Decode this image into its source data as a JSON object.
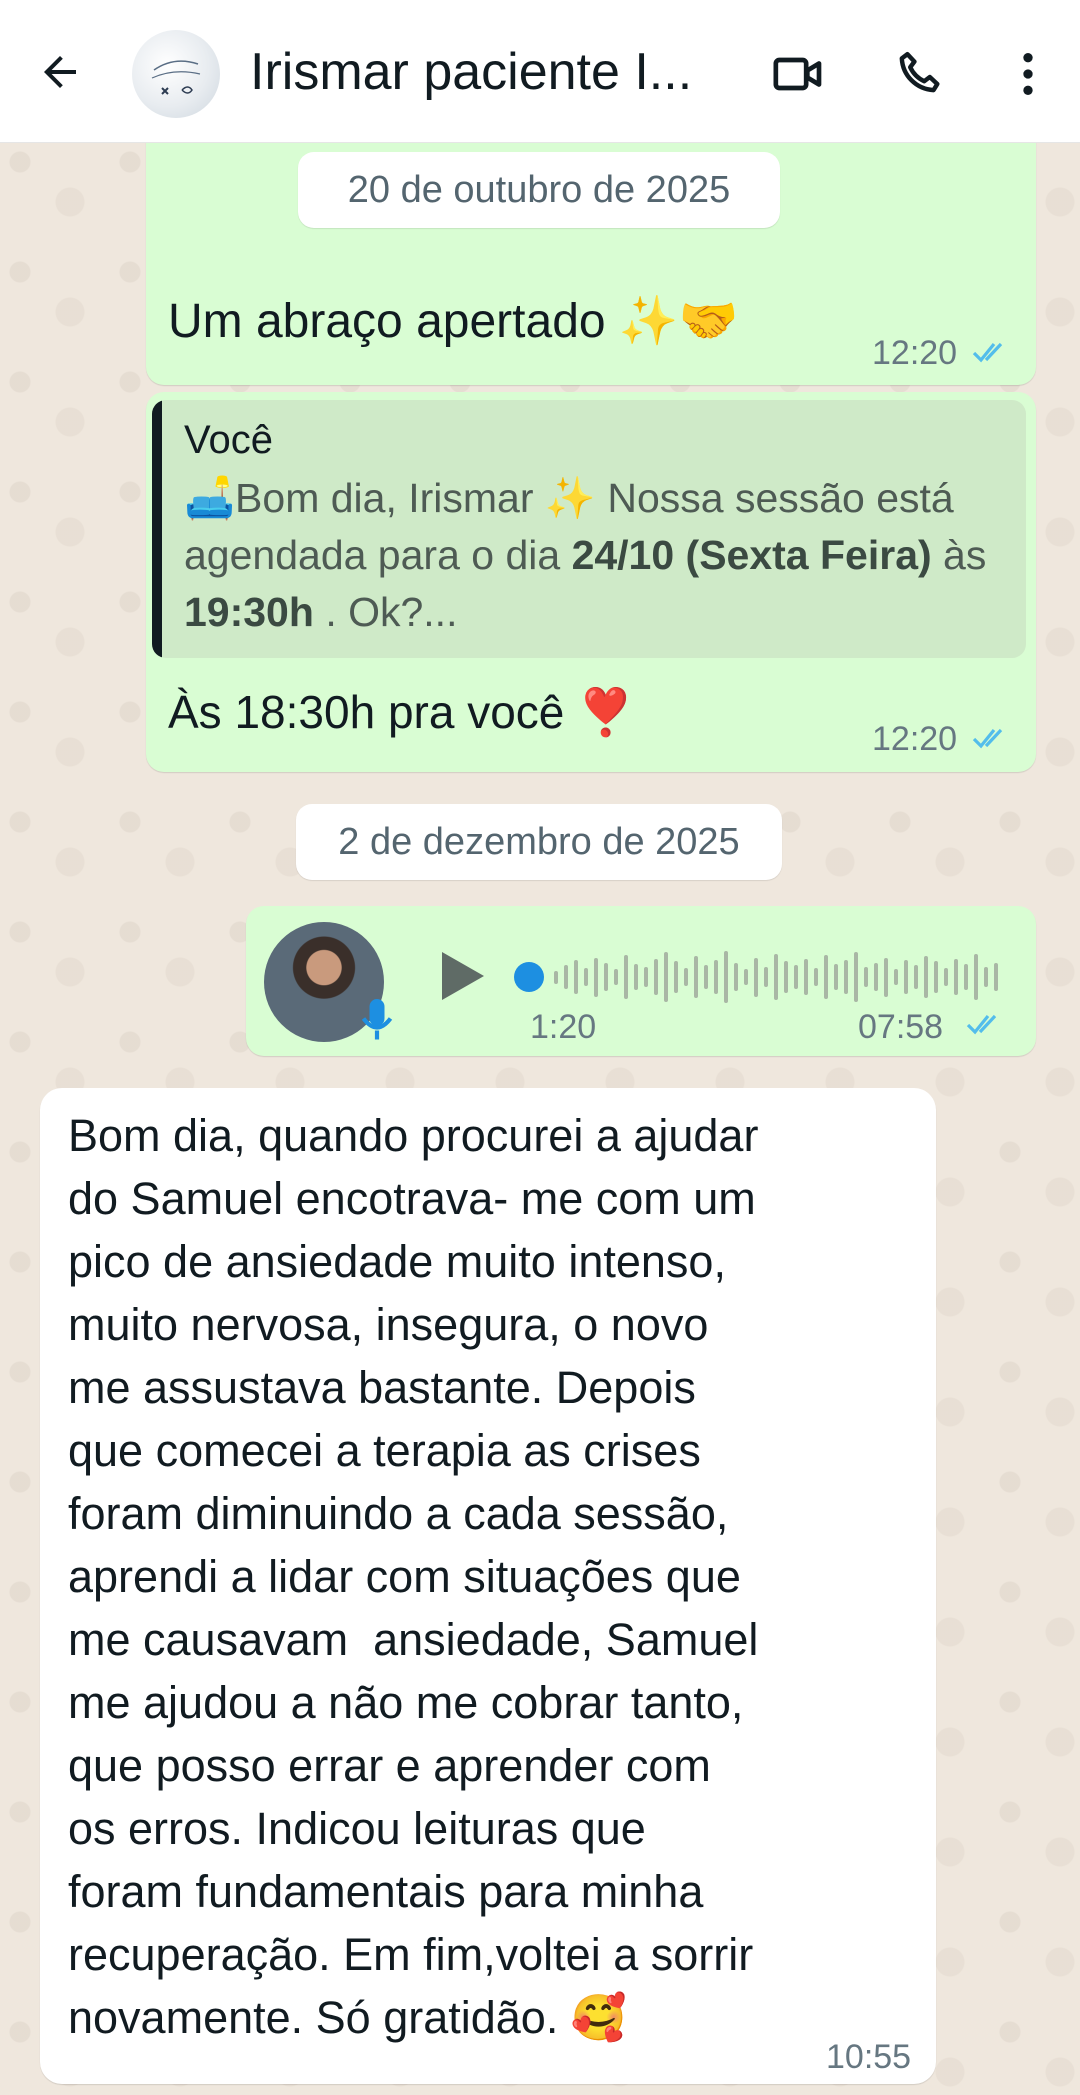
{
  "header": {
    "contact_name": "Irismar paciente I...",
    "icons": [
      "back-arrow-icon",
      "video-call-icon",
      "voice-call-icon",
      "more-options-icon"
    ]
  },
  "chat": {
    "date_1": "20 de outubro de 2025",
    "msg_1": {
      "text": "Um abraço apertado ✨🤝",
      "time": "12:20",
      "status": "read"
    },
    "msg_2": {
      "quote_author": "Você",
      "quote_part1": "🛋️Bom dia, Irismar ✨ Nossa sessão está agendada para o dia ",
      "quote_bold1": "24/10 (Sexta Feira)",
      "quote_part2": " às ",
      "quote_bold2": "19:30h",
      "quote_part3": " . Ok?...",
      "text": "Às 18:30h pra você ❣️",
      "time": "12:20",
      "status": "read"
    },
    "date_2": "2 de dezembro de 2025",
    "voice_msg": {
      "duration": "1:20",
      "time": "07:58",
      "status": "read",
      "progress": 0
    },
    "msg_in": {
      "lines": [
        "Bom dia, quando procurei a ajudar",
        "do Samuel encotrava- me com um",
        "pico de ansiedade muito intenso,",
        "muito nervosa, insegura, o novo",
        "me assustava bastante. Depois",
        "que comecei a terapia as crises",
        "foram diminuindo a cada sessão,",
        "aprendi a lidar com situações que",
        "me causavam  ansiedade, Samuel",
        "me ajudou a não me cobrar tanto,",
        "que posso errar e aprender com",
        "os erros. Indicou leituras que",
        "foram fundamentais para minha",
        "recuperação. Em fim,voltei a sorrir",
        "novamente. Só gratidão. 🥰"
      ],
      "time": "10:55"
    }
  },
  "colors": {
    "outgoing_bubble": "#d9fdd3",
    "incoming_bubble": "#ffffff",
    "read_ticks": "#53bdeb",
    "play_button": "#5f6b66",
    "voice_progress_dot": "#1d8fe1"
  }
}
